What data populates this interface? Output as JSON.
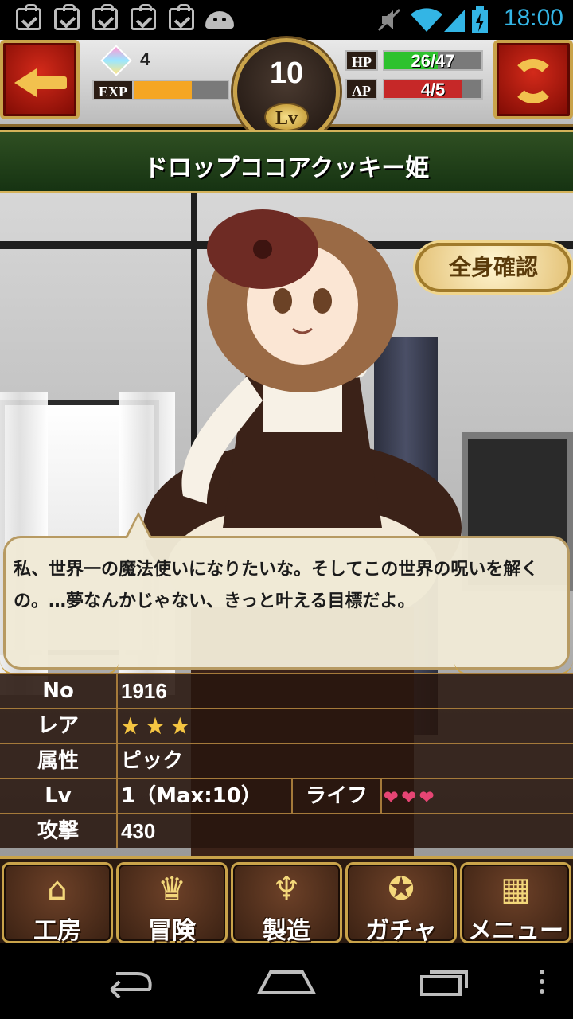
{
  "status_bar": {
    "time": "18:00",
    "notification_icons": [
      "clipboard-check-icon",
      "clipboard-check-icon",
      "clipboard-check-icon",
      "clipboard-check-icon",
      "clipboard-check-icon",
      "android-icon"
    ],
    "right_icons": [
      "no-sound-icon",
      "wifi-icon",
      "signal-icon",
      "battery-charging-icon"
    ]
  },
  "header": {
    "gems": "4",
    "exp_label": "EXP",
    "exp_progress": 0.62,
    "level": "10",
    "level_badge": "Lv",
    "hp_label": "HP",
    "hp_text": "26/47",
    "hp_progress": 0.553,
    "ap_label": "AP",
    "ap_text": "4/5",
    "ap_progress": 0.8,
    "colors": {
      "hp": "#2ec22e",
      "ap": "#c62828",
      "exp": "#f5a623",
      "gold": "#c9a34a"
    }
  },
  "character": {
    "name": "ドロップココアクッキー姫",
    "fullbody_button": "全身確認",
    "quote": "私、世界一の魔法使いになりたいな。そしてこの世界の呪いを解くの。…夢なんかじゃない、きっと叶える目標だよ。"
  },
  "stats": {
    "rows": [
      {
        "label": "No",
        "value": "1916"
      },
      {
        "label": "レア",
        "stars": 3
      },
      {
        "label": "属性",
        "value": "ピック"
      },
      {
        "label": "Lv",
        "value": "1（Max:10）",
        "extra_label": "ライフ",
        "hearts": 3
      },
      {
        "label": "攻撃",
        "value": "430"
      }
    ]
  },
  "nav": {
    "items": [
      {
        "label": "工房",
        "icon": "house-icon"
      },
      {
        "label": "冒険",
        "icon": "heels-icon"
      },
      {
        "label": "製造",
        "icon": "whisk-icon"
      },
      {
        "label": "ガチャ",
        "icon": "medallion-icon"
      },
      {
        "label": "メニュー",
        "icon": "grid-menu-icon"
      }
    ]
  },
  "system_nav": [
    "back-icon",
    "home-icon",
    "recent-apps-icon",
    "overflow-icon"
  ]
}
